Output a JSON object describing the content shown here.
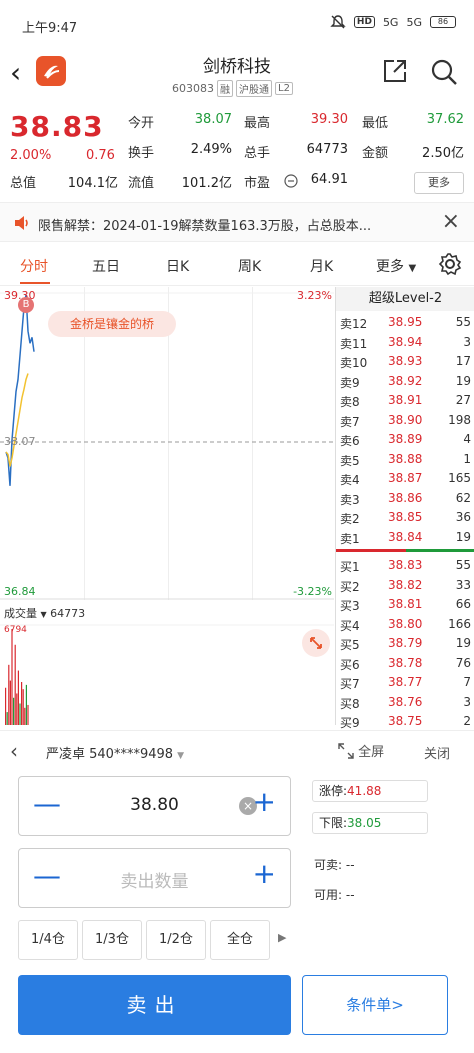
{
  "status_bar": {
    "time": "上午9:47",
    "network1": "5G",
    "network2": "5G",
    "battery": "86"
  },
  "nav": {
    "title": "剑桥科技",
    "code": "603083",
    "tags": [
      "融",
      "沪股通",
      "L2"
    ]
  },
  "quote": {
    "price": "38.83",
    "change_pct": "2.00%",
    "change": "0.76",
    "rows": [
      [
        {
          "label": "今开",
          "value": "38.07",
          "color": "green"
        },
        {
          "label": "最高",
          "value": "39.30",
          "color": "red"
        },
        {
          "label": "最低",
          "value": "37.62",
          "color": "green"
        }
      ],
      [
        {
          "label": "换手",
          "value": "2.49%",
          "color": "plain"
        },
        {
          "label": "总手",
          "value": "64773",
          "color": "plain"
        },
        {
          "label": "金额",
          "value": "2.50亿",
          "color": "plain"
        }
      ],
      [
        {
          "label": "总值",
          "value": "104.1亿",
          "color": "plain"
        },
        {
          "label": "流值",
          "value": "101.2亿",
          "color": "plain"
        },
        {
          "label": "市盈",
          "value": "64.91",
          "color": "plain"
        }
      ]
    ],
    "more": "更多"
  },
  "notice": {
    "text": "限售解禁：2024-01-19解禁数量163.3万股，占总股本..."
  },
  "tabs": [
    "分时",
    "五日",
    "日K",
    "周K",
    "月K",
    "更多"
  ],
  "chart": {
    "high_price": "39.30",
    "high_pct": "3.23%",
    "base_price": "38.07",
    "low_price": "36.84",
    "low_pct": "-3.23%",
    "promo": "金桥是镶金的桥",
    "buy_marker": "B",
    "volume_label": "成交量",
    "volume_value": "64773",
    "volume_scale": "6794"
  },
  "chart_data": {
    "type": "line",
    "ylim": [
      36.84,
      39.3
    ],
    "series": [
      {
        "values": [
          38.0,
          37.95,
          37.72,
          38.1,
          38.3,
          38.5,
          38.6,
          38.8,
          39.0,
          39.2,
          39.3,
          39.0,
          38.9,
          38.95,
          38.83
        ]
      },
      {
        "values": [
          38.0,
          37.98,
          37.88,
          37.95,
          38.05,
          38.15,
          38.25,
          38.35,
          38.45,
          38.52,
          38.6,
          38.65
        ]
      }
    ],
    "volume": [
      2600,
      900,
      4200,
      3100,
      6700,
      1900,
      5600,
      2200,
      3800,
      1500,
      3000,
      2500,
      1200,
      2800,
      1400
    ]
  },
  "book": {
    "header": "超级Level-2",
    "asks": [
      {
        "name": "卖12",
        "price": "38.95",
        "vol": "55"
      },
      {
        "name": "卖11",
        "price": "38.94",
        "vol": "3"
      },
      {
        "name": "卖10",
        "price": "38.93",
        "vol": "17"
      },
      {
        "name": "卖9",
        "price": "38.92",
        "vol": "19"
      },
      {
        "name": "卖8",
        "price": "38.91",
        "vol": "27"
      },
      {
        "name": "卖7",
        "price": "38.90",
        "vol": "198"
      },
      {
        "name": "卖6",
        "price": "38.89",
        "vol": "4"
      },
      {
        "name": "卖5",
        "price": "38.88",
        "vol": "1"
      },
      {
        "name": "卖4",
        "price": "38.87",
        "vol": "165"
      },
      {
        "name": "卖3",
        "price": "38.86",
        "vol": "62"
      },
      {
        "name": "卖2",
        "price": "38.85",
        "vol": "36"
      },
      {
        "name": "卖1",
        "price": "38.84",
        "vol": "19"
      }
    ],
    "bids": [
      {
        "name": "买1",
        "price": "38.83",
        "vol": "55"
      },
      {
        "name": "买2",
        "price": "38.82",
        "vol": "33"
      },
      {
        "name": "买3",
        "price": "38.81",
        "vol": "66"
      },
      {
        "name": "买4",
        "price": "38.80",
        "vol": "166"
      },
      {
        "name": "买5",
        "price": "38.79",
        "vol": "19"
      },
      {
        "name": "买6",
        "price": "38.78",
        "vol": "76"
      },
      {
        "name": "买7",
        "price": "38.77",
        "vol": "7"
      },
      {
        "name": "买8",
        "price": "38.76",
        "vol": "3"
      },
      {
        "name": "买9",
        "price": "38.75",
        "vol": "2"
      }
    ]
  },
  "trade": {
    "account": "严凌卓 540****9498",
    "fullscreen": "全屏",
    "close": "关闭",
    "price": "38.80",
    "qty_placeholder": "卖出数量",
    "limit_up_label": "涨停:",
    "limit_up": "41.88",
    "limit_down_label": "下限:",
    "limit_down": "38.05",
    "can_sell": "可卖: --",
    "can_use": "可用: --",
    "fractions": [
      "1/4仓",
      "1/3仓",
      "1/2仓",
      "全仓"
    ],
    "sell": "卖出",
    "conditional": "条件单>"
  },
  "colors": {
    "red": "#d9282e",
    "green": "#1f9a3a",
    "accent": "#e8542a",
    "blue": "#2a7de1"
  }
}
